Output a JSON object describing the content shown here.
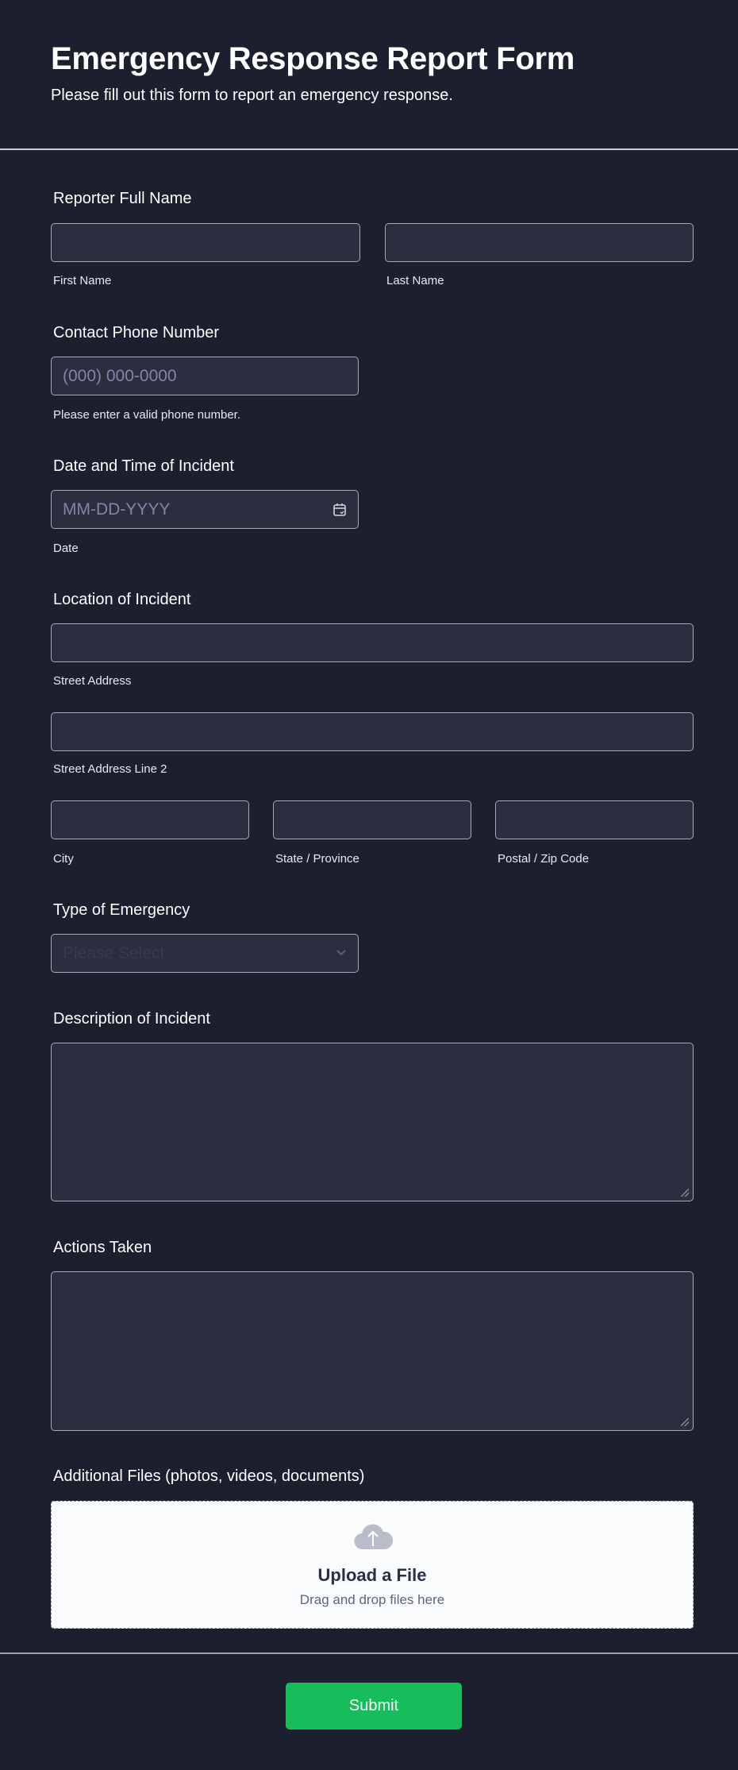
{
  "header": {
    "title": "Emergency Response Report Form",
    "subtitle": "Please fill out this form to report an emergency response."
  },
  "fields": {
    "name": {
      "label": "Reporter Full Name",
      "first": "First Name",
      "last": "Last Name"
    },
    "phone": {
      "label": "Contact Phone Number",
      "placeholder": "(000) 000-0000",
      "help": "Please enter a valid phone number."
    },
    "date": {
      "label": "Date and Time of Incident",
      "placeholder": "MM-DD-YYYY",
      "help": "Date"
    },
    "location": {
      "label": "Location of Incident",
      "street": "Street Address",
      "street2": "Street Address Line 2",
      "city": "City",
      "state": "State / Province",
      "zip": "Postal / Zip Code"
    },
    "type": {
      "label": "Type of Emergency",
      "placeholder": "Please Select"
    },
    "description": {
      "label": "Description of Incident"
    },
    "actions": {
      "label": "Actions Taken"
    },
    "files": {
      "label": "Additional Files (photos, videos, documents)",
      "title": "Upload a File",
      "hint": "Drag and drop files here"
    }
  },
  "submit": {
    "label": "Submit"
  },
  "colors": {
    "accent": "#18bd5b",
    "background": "#1c1f2e",
    "input": "#2c2e3f"
  }
}
